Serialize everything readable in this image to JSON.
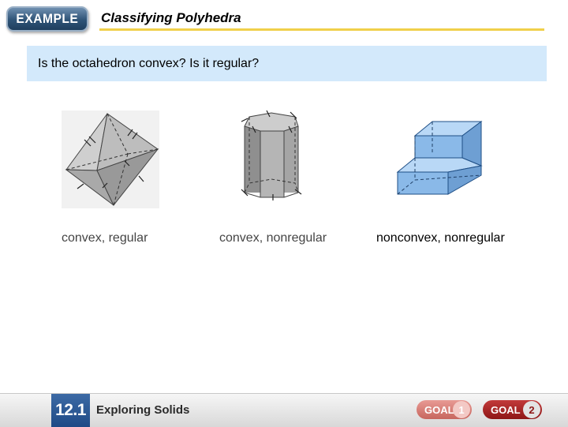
{
  "header": {
    "badge_label": "EXAMPLE",
    "title": "Classifying Polyhedra"
  },
  "question": {
    "text": "Is the octahedron convex? Is it regular?"
  },
  "figures": [
    {
      "icon": "octahedron-figure",
      "caption": "convex, regular"
    },
    {
      "icon": "hexagonal-prism-figure",
      "caption": "convex, nonregular"
    },
    {
      "icon": "stepped-block-figure",
      "caption": "nonconvex, nonregular"
    }
  ],
  "footer": {
    "section_number": "12.1",
    "section_title": "Exploring Solids",
    "goal1_label": "GOAL",
    "goal1_number": "1",
    "goal2_label": "GOAL",
    "goal2_number": "2"
  }
}
